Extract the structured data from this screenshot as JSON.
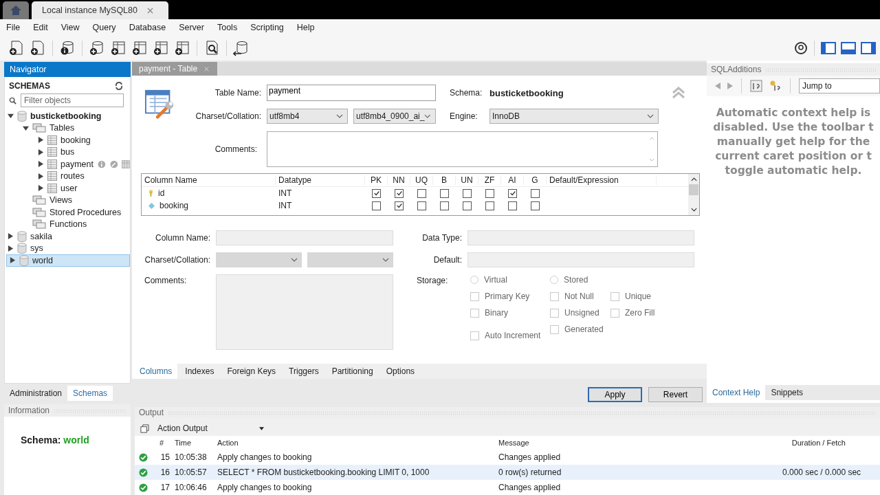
{
  "app_tabs": [
    {
      "kind": "home",
      "selected": false
    },
    {
      "kind": "connection",
      "label": "Local instance MySQL80",
      "selected": true
    }
  ],
  "menu": [
    "File",
    "Edit",
    "View",
    "Query",
    "Database",
    "Server",
    "Tools",
    "Scripting",
    "Help"
  ],
  "navigator": {
    "title": "Navigator",
    "heading": "SCHEMAS",
    "filter": {
      "placeholder": "Filter objects"
    },
    "tree": [
      {
        "label": "busticketbooking",
        "kind": "schema",
        "bold": true,
        "expanded": true,
        "selected": false,
        "children": [
          {
            "label": "Tables",
            "kind": "folder",
            "expanded": true,
            "selected": false,
            "children": [
              {
                "label": "booking",
                "kind": "table",
                "expanded": false,
                "selected": false,
                "hovered": false
              },
              {
                "label": "bus",
                "kind": "table",
                "expanded": false,
                "selected": false,
                "hovered": false
              },
              {
                "label": "payment",
                "kind": "table",
                "expanded": false,
                "selected": false,
                "hovered": true
              },
              {
                "label": "routes",
                "kind": "table",
                "expanded": false,
                "selected": false,
                "hovered": false
              },
              {
                "label": "user",
                "kind": "table",
                "expanded": false,
                "selected": false,
                "hovered": false
              }
            ]
          },
          {
            "label": "Views",
            "kind": "folder",
            "selected": false
          },
          {
            "label": "Stored Procedures",
            "kind": "folder",
            "selected": false
          },
          {
            "label": "Functions",
            "kind": "folder",
            "selected": false
          }
        ]
      },
      {
        "label": "sakila",
        "kind": "schema",
        "bold": false,
        "expanded": false,
        "selected": false
      },
      {
        "label": "sys",
        "kind": "schema",
        "bold": false,
        "expanded": false,
        "selected": false
      },
      {
        "label": "world",
        "kind": "schema",
        "bold": false,
        "expanded": false,
        "selected": true
      }
    ],
    "tabs": [
      {
        "label": "Administration",
        "selected": false
      },
      {
        "label": "Schemas",
        "selected": true
      }
    ]
  },
  "information": {
    "title": "Information",
    "schema_label": "Schema:",
    "schema_value": "world"
  },
  "editor": {
    "tab": "payment - Table",
    "table_name_label": "Table Name:",
    "table_name": "payment",
    "schema_label": "Schema:",
    "schema": "busticketbooking",
    "charset_label": "Charset/Collation:",
    "charset": "utf8mb4",
    "collation": "utf8mb4_0900_ai_",
    "engine_label": "Engine:",
    "engine": "InnoDB",
    "comments_label": "Comments:",
    "grid": {
      "columns": [
        "Column Name",
        "Datatype",
        "PK",
        "NN",
        "UQ",
        "B",
        "UN",
        "ZF",
        "AI",
        "G",
        "Default/Expression"
      ],
      "rows": [
        {
          "kind": "primary",
          "name": "id",
          "datatype": "INT",
          "flags": [
            true,
            true,
            false,
            false,
            false,
            false,
            true,
            false
          ]
        },
        {
          "kind": "regular",
          "name": "booking",
          "datatype": "INT",
          "flags": [
            false,
            true,
            false,
            false,
            false,
            false,
            false,
            false
          ]
        }
      ]
    },
    "detail": {
      "column_name_label": "Column Name:",
      "charset_label": "Charset/Collation:",
      "comments_label": "Comments:",
      "data_type_label": "Data Type:",
      "default_label": "Default:",
      "storage_label": "Storage:",
      "radios": [
        {
          "label": "Virtual",
          "selected": false
        },
        {
          "label": "Stored",
          "selected": false
        }
      ],
      "checks": [
        {
          "label": "Primary Key",
          "checked": false
        },
        {
          "label": "Not Null",
          "checked": false
        },
        {
          "label": "Unique",
          "checked": false
        },
        {
          "label": "Binary",
          "checked": false
        },
        {
          "label": "Unsigned",
          "checked": false
        },
        {
          "label": "Zero Fill",
          "checked": false
        },
        {
          "label": "Auto Increment",
          "checked": false
        },
        {
          "label": "Generated",
          "checked": false
        }
      ]
    },
    "subtabs": [
      {
        "label": "Columns",
        "selected": true
      },
      {
        "label": "Indexes",
        "selected": false
      },
      {
        "label": "Foreign Keys",
        "selected": false
      },
      {
        "label": "Triggers",
        "selected": false
      },
      {
        "label": "Partitioning",
        "selected": false
      },
      {
        "label": "Options",
        "selected": false
      }
    ],
    "buttons": [
      {
        "label": "Apply",
        "default": true
      },
      {
        "label": "Revert",
        "default": false
      }
    ]
  },
  "sql_additions": {
    "title": "SQLAdditions",
    "jump_to": "Jump to",
    "help_text": [
      "Automatic context help is",
      "disabled. Use the toolbar t",
      "manually get help for the",
      "current caret position or t",
      "toggle automatic help."
    ],
    "tabs": [
      {
        "label": "Context Help",
        "selected": true
      },
      {
        "label": "Snippets",
        "selected": false
      }
    ]
  },
  "output": {
    "title": "Output",
    "selector": "Action Output",
    "columns": [
      "#",
      "Time",
      "Action",
      "Message",
      "Duration / Fetch"
    ],
    "rows": [
      {
        "kind": "success",
        "selected": false,
        "number": "15",
        "time": "10:05:38",
        "action": "Apply changes to booking",
        "message": "Changes applied"
      },
      {
        "kind": "success",
        "selected": true,
        "number": "16",
        "time": "10:05:57",
        "action": "SELECT * FROM busticketbooking.booking LIMIT 0, 1000",
        "message": "0 row(s) returned",
        "duration": "0.000 sec / 0.000 sec"
      },
      {
        "kind": "success",
        "selected": false,
        "number": "17",
        "time": "10:06:46",
        "action": "Apply changes to booking",
        "message": "Changes applied"
      }
    ]
  }
}
